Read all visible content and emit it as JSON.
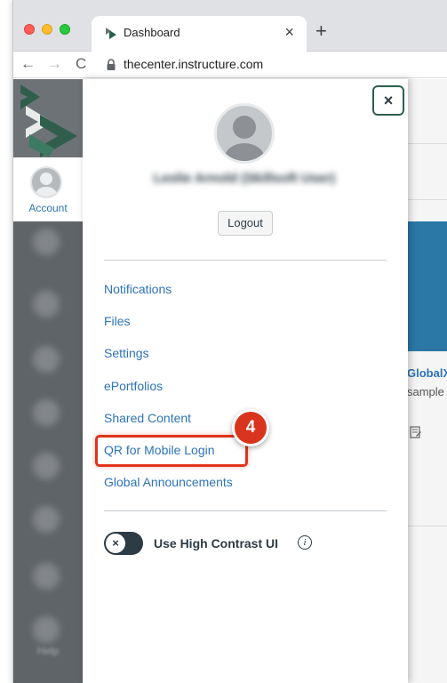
{
  "browser": {
    "tab_title": "Dashboard",
    "tab_close": "×",
    "new_tab": "+",
    "back": "←",
    "forward": "→",
    "reload": "C",
    "url": "thecenter.instructure.com"
  },
  "global_nav": {
    "account_label": "Account",
    "help_label": "Help"
  },
  "tray": {
    "close": "×",
    "user_name": "Leslie Arnold (Skillsoft User)",
    "logout_label": "Logout",
    "links": [
      "Notifications",
      "Files",
      "Settings",
      "ePortfolios",
      "Shared Content",
      "QR for Mobile Login",
      "Global Announcements"
    ],
    "high_contrast_label": "Use High Contrast UI",
    "toggle_glyph": "×",
    "info_glyph": "i"
  },
  "callout": {
    "step_number": "4"
  },
  "background": {
    "course_title": "GlobalX",
    "course_sub": "sample"
  },
  "colors": {
    "link": "#2d73b9",
    "highlight": "#e0331c",
    "nav_bg": "#5f6468",
    "close_border": "#2e5e4e"
  }
}
